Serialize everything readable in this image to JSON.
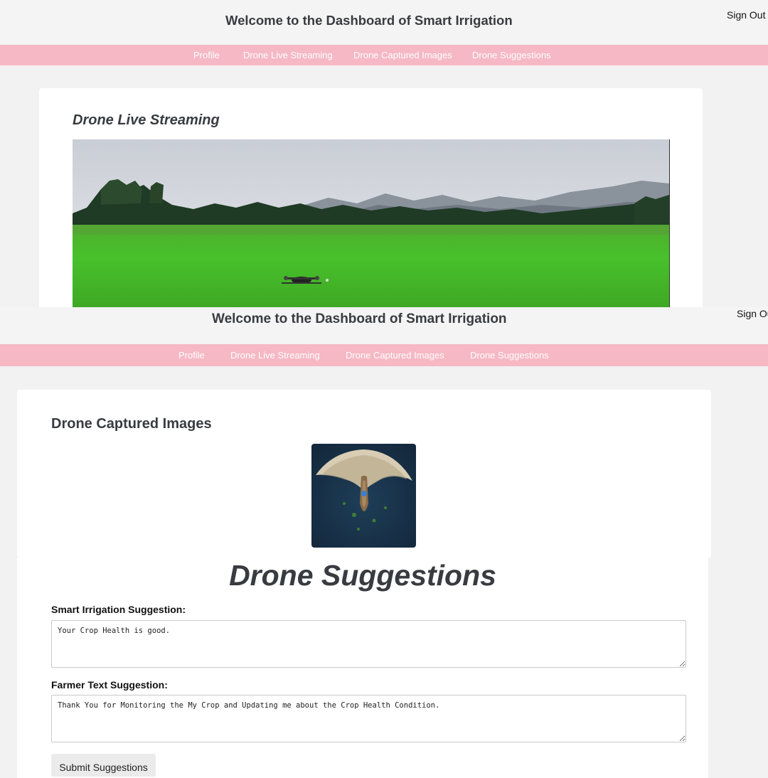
{
  "site": {
    "title": "Welcome to the Dashboard of Smart Irrigation",
    "sign_out": "Sign Out",
    "nav": [
      "Profile",
      "Drone Live Streaming",
      "Drone Captured Images",
      "Drone Suggestions"
    ]
  },
  "section_header_repeat": {
    "title": "Welcome to the Dashboard of Smart Irrigation",
    "sign_out": "Sign Out"
  },
  "live_streaming": {
    "title": "Drone Live Streaming"
  },
  "captured_images": {
    "title": "Drone Captured Images"
  },
  "suggestions": {
    "title": "Drone Suggestions",
    "irrigation_label": "Smart Irrigation Suggestion:",
    "irrigation_value": "Your Crop Health is good.",
    "farmer_label": "Farmer Text Suggestion:",
    "farmer_value": "Thank You for Monitoring the My Crop and Updating me about the Crop Health Condition.",
    "submit_label": "Submit Suggestions"
  },
  "colors": {
    "nav_background": "#f5b8c4",
    "nav_text": "#ffffff",
    "title_text": "#383b40"
  }
}
